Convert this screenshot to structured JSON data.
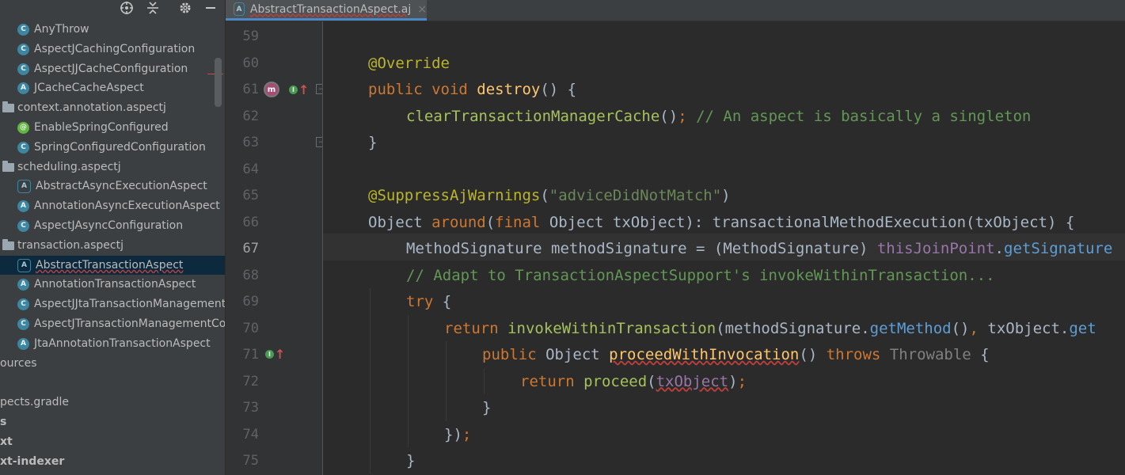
{
  "sidebar": {
    "toolbar_icons": [
      "locate-icon",
      "collapse-icon",
      "gear-icon",
      "hide-icon"
    ],
    "items": [
      {
        "label": "AnyThrow",
        "icon": "class",
        "indent": 22
      },
      {
        "label": "AspectJCachingConfiguration",
        "icon": "class",
        "indent": 22
      },
      {
        "label": "AspectJJCacheConfiguration",
        "icon": "class",
        "indent": 22
      },
      {
        "label": "JCacheCacheAspect",
        "icon": "aspect",
        "indent": 22
      },
      {
        "label": "context.annotation.aspectj",
        "icon": "folder",
        "indent": 0
      },
      {
        "label": "EnableSpringConfigured",
        "icon": "annotation",
        "indent": 22
      },
      {
        "label": "SpringConfiguredConfiguration",
        "icon": "class",
        "indent": 22
      },
      {
        "label": "scheduling.aspectj",
        "icon": "folder",
        "indent": 0
      },
      {
        "label": "AbstractAsyncExecutionAspect",
        "icon": "abstract-aspect",
        "indent": 22
      },
      {
        "label": "AnnotationAsyncExecutionAspect",
        "icon": "aspect",
        "indent": 22
      },
      {
        "label": "AspectJAsyncConfiguration",
        "icon": "class",
        "indent": 22
      },
      {
        "label": "transaction.aspectj",
        "icon": "folder",
        "indent": 0
      },
      {
        "label": "AbstractTransactionAspect",
        "icon": "abstract-aspect",
        "indent": 22,
        "selected": true
      },
      {
        "label": "AnnotationTransactionAspect",
        "icon": "aspect",
        "indent": 22
      },
      {
        "label": "AspectJJtaTransactionManagement",
        "icon": "class",
        "indent": 22
      },
      {
        "label": "AspectJTransactionManagementCo",
        "icon": "class",
        "indent": 22
      },
      {
        "label": "JtaAnnotationTransactionAspect",
        "icon": "aspect",
        "indent": 22
      },
      {
        "label": "ources",
        "icon": "none",
        "indent": 0
      },
      {
        "label": "",
        "icon": "none",
        "indent": 0
      },
      {
        "label": "pects.gradle",
        "icon": "none",
        "indent": 0
      },
      {
        "label": "s",
        "icon": "none",
        "indent": 0,
        "bold": true
      },
      {
        "label": "xt",
        "icon": "none",
        "indent": 0,
        "bold": true
      },
      {
        "label": "xt-indexer",
        "icon": "none",
        "indent": 0,
        "bold": true
      }
    ]
  },
  "tab": {
    "label": "AbstractTransactionAspect.aj",
    "icon": "abstract-aspect-icon",
    "close": "×"
  },
  "editor": {
    "current_line": 67,
    "lines": [
      {
        "n": "59",
        "indent": 0,
        "tokens": []
      },
      {
        "n": "60",
        "indent": 1,
        "tokens": [
          {
            "t": "@Override",
            "c": "ann"
          }
        ]
      },
      {
        "n": "61",
        "indent": 1,
        "tokens": [
          {
            "t": "public void ",
            "c": "kw"
          },
          {
            "t": "destroy",
            "c": "fn"
          },
          {
            "t": "() {",
            "c": "plain"
          }
        ]
      },
      {
        "n": "62",
        "indent": 2,
        "tokens": [
          {
            "t": "clearTransactionManagerCache",
            "c": "mcall"
          },
          {
            "t": "()",
            "c": "plain"
          },
          {
            "t": "; ",
            "c": "kw"
          },
          {
            "t": "// An aspect is basically a singleton",
            "c": "cmt"
          }
        ]
      },
      {
        "n": "63",
        "indent": 1,
        "tokens": [
          {
            "t": "}",
            "c": "plain"
          }
        ]
      },
      {
        "n": "64",
        "indent": 0,
        "tokens": []
      },
      {
        "n": "65",
        "indent": 1,
        "tokens": [
          {
            "t": "@SuppressAjWarnings",
            "c": "ann"
          },
          {
            "t": "(",
            "c": "plain"
          },
          {
            "t": "\"adviceDidNotMatch\"",
            "c": "str"
          },
          {
            "t": ")",
            "c": "plain"
          }
        ]
      },
      {
        "n": "66",
        "indent": 1,
        "tokens": [
          {
            "t": "Object ",
            "c": "plain"
          },
          {
            "t": "around",
            "c": "kw"
          },
          {
            "t": "(",
            "c": "plain"
          },
          {
            "t": "final ",
            "c": "kw"
          },
          {
            "t": "Object txObject): transactionalMethodExecution(txObject) {",
            "c": "plain"
          }
        ]
      },
      {
        "n": "67",
        "indent": 2,
        "tokens": [
          {
            "t": "MethodSignature methodSignature = (MethodSignature) ",
            "c": "plain"
          },
          {
            "t": "thisJoinPoint",
            "c": "purple"
          },
          {
            "t": ".",
            "c": "plain"
          },
          {
            "t": "getSignature",
            "c": "blue"
          }
        ]
      },
      {
        "n": "68",
        "indent": 2,
        "tokens": [
          {
            "t": "// Adapt to TransactionAspectSupport's invokeWithinTransaction...",
            "c": "cmt"
          }
        ]
      },
      {
        "n": "69",
        "indent": 2,
        "tokens": [
          {
            "t": "try ",
            "c": "kw"
          },
          {
            "t": "{",
            "c": "plain"
          }
        ]
      },
      {
        "n": "70",
        "indent": 3,
        "tokens": [
          {
            "t": "return ",
            "c": "kw"
          },
          {
            "t": "invokeWithinTransaction",
            "c": "mcall"
          },
          {
            "t": "(methodSignature.",
            "c": "plain"
          },
          {
            "t": "getMethod",
            "c": "blue"
          },
          {
            "t": "()",
            "c": "plain"
          },
          {
            "t": ", ",
            "c": "kw"
          },
          {
            "t": "txObject.",
            "c": "plain"
          },
          {
            "t": "get",
            "c": "blue"
          }
        ]
      },
      {
        "n": "71",
        "indent": 4,
        "tokens": [
          {
            "t": "public ",
            "c": "kw"
          },
          {
            "t": "Object ",
            "c": "plain"
          },
          {
            "t": "proceedWithInvocation",
            "c": "fn"
          },
          {
            "t": "() ",
            "c": "plain"
          },
          {
            "t": "throws ",
            "c": "kw"
          },
          {
            "t": "Throwable ",
            "c": "cmt2"
          },
          {
            "t": "{",
            "c": "plain"
          }
        ]
      },
      {
        "n": "72",
        "indent": 5,
        "tokens": [
          {
            "t": "return ",
            "c": "kw"
          },
          {
            "t": "proceed",
            "c": "mcall"
          },
          {
            "t": "(",
            "c": "plain"
          },
          {
            "t": "txObject",
            "c": "purple"
          },
          {
            "t": ")",
            "c": "plain"
          },
          {
            "t": ";",
            "c": "kw"
          }
        ]
      },
      {
        "n": "73",
        "indent": 4,
        "tokens": [
          {
            "t": "}",
            "c": "plain"
          }
        ]
      },
      {
        "n": "74",
        "indent": 3,
        "tokens": [
          {
            "t": "})",
            "c": "plain"
          },
          {
            "t": ";",
            "c": "kw"
          }
        ]
      },
      {
        "n": "75",
        "indent": 2,
        "tokens": [
          {
            "t": "}",
            "c": "plain"
          }
        ]
      }
    ]
  },
  "gutter_markers": [
    {
      "line": "61",
      "markers": [
        "overridden-method-icon",
        "implemented-up-icon"
      ]
    },
    {
      "line": "71",
      "markers": [
        "implemented-up-icon"
      ]
    }
  ],
  "colors": {
    "keyword": "#cc7832",
    "annotation": "#bbb529",
    "method_decl": "#ffc66d",
    "comment": "#629755",
    "string": "#6a8759",
    "field": "#9876aa",
    "background": "#2b2b2b",
    "selection": "#0d293e"
  }
}
